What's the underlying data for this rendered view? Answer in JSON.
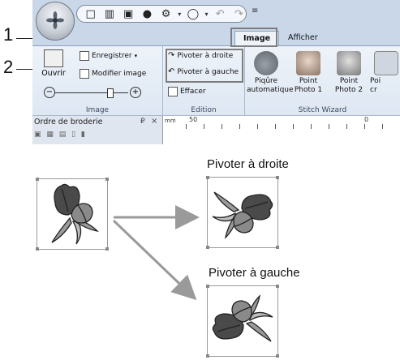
{
  "callouts": {
    "one": "1",
    "two": "2"
  },
  "ribbon": {
    "tabs": {
      "image": "Image",
      "afficher": "Afficher"
    },
    "groups": {
      "image": {
        "label": "Image",
        "open_label": "Ouvrir",
        "save_label": "Enregistrer",
        "modify_label": "Modifier image"
      },
      "edition": {
        "label": "Edition",
        "rotate_right": "Pivoter à droite",
        "rotate_left": "Pivoter à gauche",
        "erase": "Effacer"
      },
      "stitch_wizard": {
        "label": "Stitch Wizard",
        "buttons": [
          {
            "line1": "Piqûre",
            "line2": "automatique"
          },
          {
            "line1": "Point",
            "line2": "Photo 1"
          },
          {
            "line1": "Point",
            "line2": "Photo 2"
          },
          {
            "line1": "Poi",
            "line2": "cr"
          }
        ]
      }
    }
  },
  "panel": {
    "title": "Ordre de broderie",
    "pin": "₽",
    "close": "×",
    "ruler_unit": "mm",
    "ruler_left": "50",
    "ruler_right": "0"
  },
  "captions": {
    "rotate_right": "Pivoter à droite",
    "rotate_left": "Pivoter à gauche"
  },
  "colors": {
    "ribbon_bg": "#dde7f3",
    "frame": "#7d7d7d",
    "arrow": "#9a9a9a"
  }
}
